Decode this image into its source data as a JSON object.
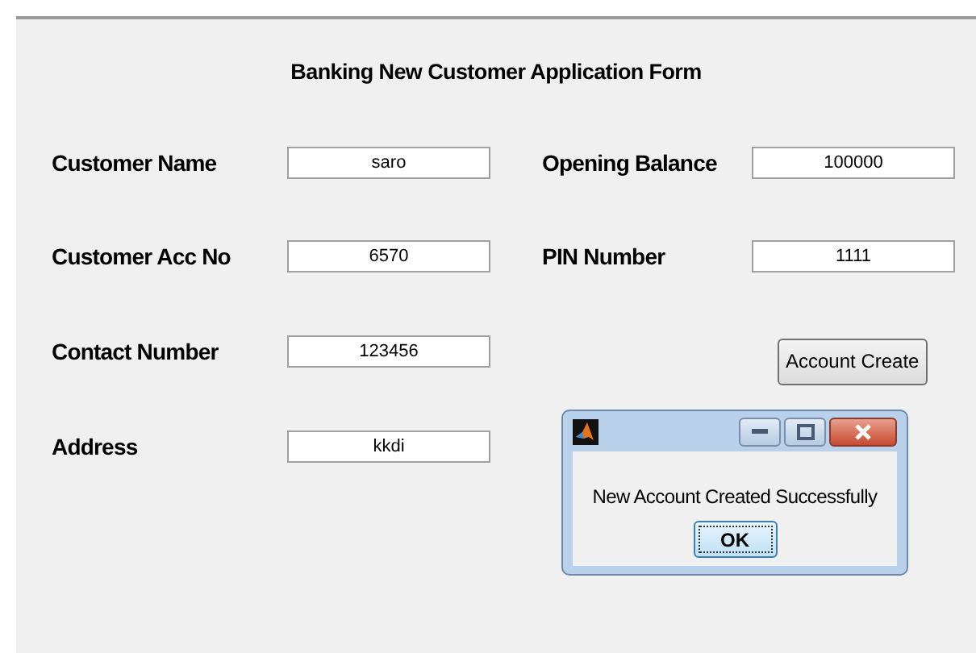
{
  "form": {
    "title": "Banking New Customer Application Form",
    "rows": [
      {
        "left": {
          "label": "Customer Name",
          "value": "saro"
        },
        "right": {
          "kind": "field",
          "label": "Opening Balance",
          "value": "100000"
        }
      },
      {
        "left": {
          "label": "Customer Acc No",
          "value": "6570"
        },
        "right": {
          "kind": "field",
          "label": "PIN Number",
          "value": "1111"
        }
      },
      {
        "left": {
          "label": "Contact Number",
          "value": "123456"
        },
        "right": {
          "kind": "button",
          "label": "Account Create"
        }
      },
      {
        "left": {
          "label": "Address",
          "value": "kkdi"
        }
      }
    ]
  },
  "dialog": {
    "message": "New Account Created Successfully",
    "button": "OK"
  }
}
